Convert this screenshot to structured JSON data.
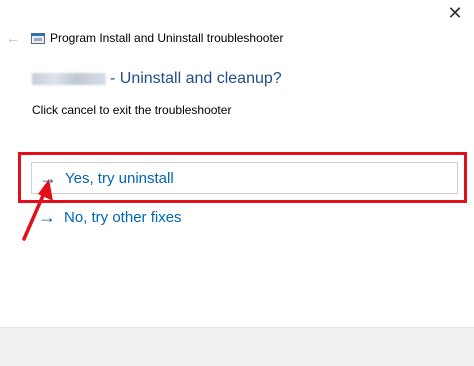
{
  "window": {
    "title": "Program Install and Uninstall troubleshooter",
    "close_label": "✕",
    "back_label": "←"
  },
  "heading": {
    "program_name_redacted": true,
    "text": "- Uninstall and cleanup?"
  },
  "subtext": "Click cancel to exit the troubleshooter",
  "options": [
    {
      "arrow": "→",
      "label": "Yes, try uninstall"
    },
    {
      "arrow": "→",
      "label": "No, try other fixes"
    }
  ],
  "colors": {
    "link": "#0066b4",
    "heading": "#1f4e8c",
    "highlight": "#e1101b"
  }
}
